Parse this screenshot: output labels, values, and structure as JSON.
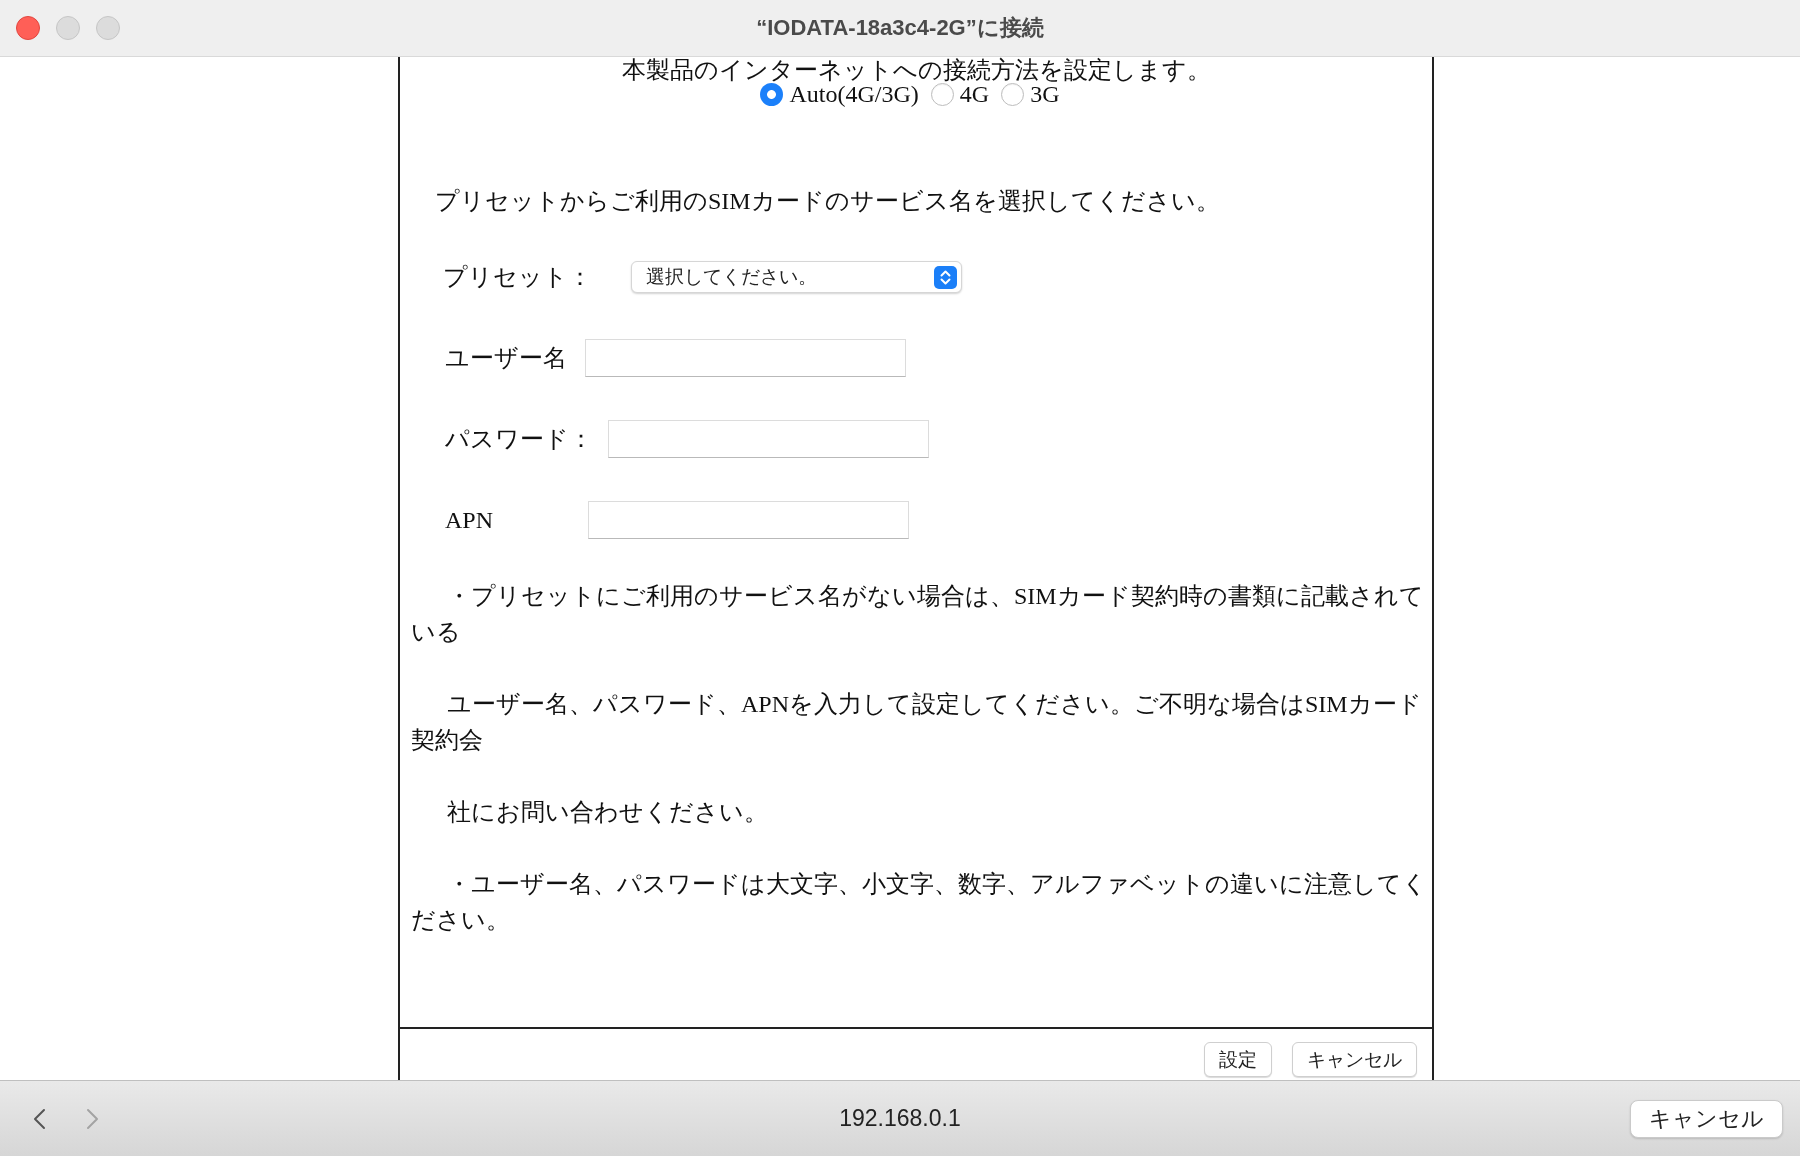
{
  "window": {
    "title": "“IODATA-18a3c4-2G”に接続",
    "controls": [
      {
        "kind": "close",
        "disabled": false
      },
      {
        "kind": "minimize",
        "disabled": true
      },
      {
        "kind": "zoom",
        "disabled": true
      }
    ]
  },
  "page": {
    "intro": "本製品のインターネットへの接続方法を設定します。",
    "connection_modes": [
      {
        "label": "Auto(4G/3G)",
        "selected": true
      },
      {
        "label": "4G",
        "selected": false
      },
      {
        "label": "3G",
        "selected": false
      }
    ],
    "preset_prompt": "プリセットからご利用のSIMカードのサービス名を選択してください。",
    "fields": [
      {
        "kind": "select",
        "label": "プリセット：",
        "value": "選択してください。"
      },
      {
        "kind": "text",
        "label": "ユーザー名"
      },
      {
        "kind": "password",
        "label": "パスワード："
      },
      {
        "kind": "text",
        "label": "APN"
      }
    ],
    "notes": [
      {
        "lines": [
          "・プリセットにご利用のサービス名がない場合は、SIMカード契約時の書類に記載されて",
          "いる"
        ]
      },
      {
        "lines": [
          "ユーザー名、パスワード、APNを入力して設定してください。ご不明な場合はSIMカード",
          "契約会"
        ]
      },
      {
        "lines": [
          "社にお問い合わせください。"
        ]
      },
      {
        "lines": [
          "・ユーザー名、パスワードは大文字、小文字、数字、アルファベットの違いに注意してく",
          "ださい。"
        ]
      }
    ],
    "buttons": [
      "設定",
      "キャンセル"
    ]
  },
  "toolbar": {
    "nav": [
      {
        "kind": "back",
        "disabled": false
      },
      {
        "kind": "forward",
        "disabled": true
      }
    ],
    "address": "192.168.0.1",
    "cancel": "キャンセル"
  }
}
